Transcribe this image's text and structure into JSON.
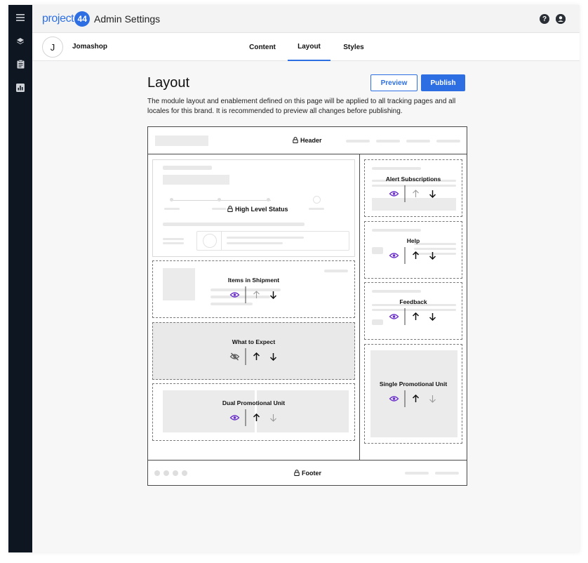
{
  "app": {
    "logo_text": "project",
    "logo_badge": "44",
    "title": "Admin Settings"
  },
  "topbar": {
    "help_icon": "help-circle-icon",
    "account_icon": "user-circle-icon",
    "help_glyph": "?",
    "account_glyph": "👤"
  },
  "sidebar": {
    "items": [
      {
        "icon": "menu-icon"
      },
      {
        "icon": "layers-icon"
      },
      {
        "icon": "clipboard-icon"
      },
      {
        "icon": "bar-chart-icon"
      }
    ]
  },
  "brand": {
    "initial": "J",
    "name": "Jomashop"
  },
  "tabs": [
    {
      "label": "Content",
      "active": false
    },
    {
      "label": "Layout",
      "active": true
    },
    {
      "label": "Styles",
      "active": false
    }
  ],
  "page": {
    "title": "Layout",
    "description": "The module layout and enablement defined on this page will be applied to all tracking pages and all locales for this brand. It is recommended to preview all changes before publishing.",
    "preview_label": "Preview",
    "publish_label": "Publish"
  },
  "layout": {
    "header_label": "Header",
    "footer_label": "Footer",
    "high_level_status_label": "High Level Status",
    "main_modules": [
      {
        "label": "Items in Shipment",
        "visible": true,
        "up_enabled": false,
        "down_enabled": true
      },
      {
        "label": "What to Expect",
        "visible": false,
        "up_enabled": true,
        "down_enabled": true
      },
      {
        "label": "Dual Promotional Unit",
        "visible": true,
        "up_enabled": true,
        "down_enabled": false
      }
    ],
    "side_modules": [
      {
        "label": "Alert Subscriptions",
        "visible": true,
        "up_enabled": false,
        "down_enabled": true
      },
      {
        "label": "Help",
        "visible": true,
        "up_enabled": true,
        "down_enabled": true
      },
      {
        "label": "Feedback",
        "visible": true,
        "up_enabled": true,
        "down_enabled": true
      },
      {
        "label": "Single Promotional Unit",
        "visible": true,
        "up_enabled": true,
        "down_enabled": false
      }
    ]
  },
  "colors": {
    "primary": "#2d6fe3",
    "eye_visible": "#6a2fc9",
    "eye_hidden": "#555555",
    "arrow_enabled": "#111111",
    "arrow_disabled": "#9a9a9a",
    "sidebar_bg": "#0e1621"
  }
}
